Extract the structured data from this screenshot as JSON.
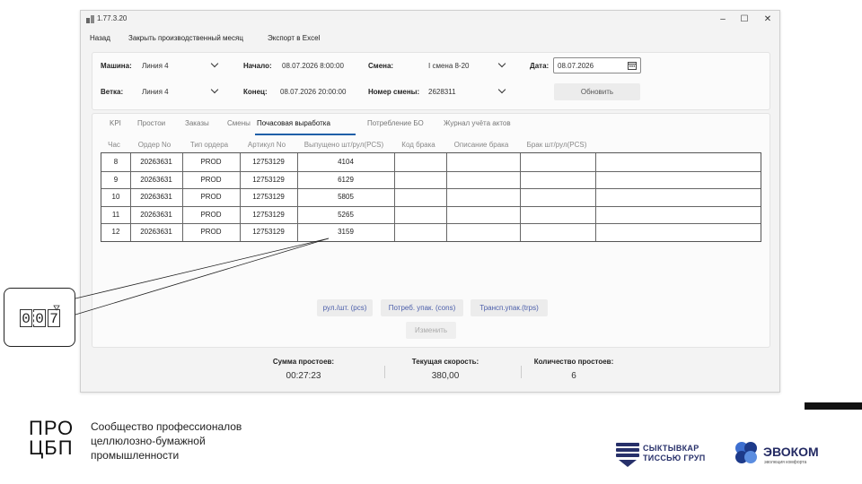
{
  "window": {
    "title": "1.77.3.20",
    "minimize": "–",
    "maximize": "☐",
    "close": "✕"
  },
  "menu": {
    "back": "Назад",
    "close_month": "Закрыть производственный месяц",
    "export": "Экспорт в Excel"
  },
  "filters": {
    "machine_label": "Машина:",
    "machine_value": "Линия 4",
    "start_label": "Начало:",
    "start_value": "08.07.2026 8:00:00",
    "shift_label": "Смена:",
    "shift_value": "I смена 8-20",
    "date_label": "Дата:",
    "date_value": "08.07.2026",
    "branch_label": "Ветка:",
    "branch_value": "Линия 4",
    "end_label": "Конец:",
    "end_value": "08.07.2026 20:00:00",
    "shift_no_label": "Номер смены:",
    "shift_no_value": "2628311",
    "refresh": "Обновить"
  },
  "tabs": [
    "KPI",
    "Простои",
    "Заказы",
    "Смены",
    "Почасовая выработка",
    "Потребление БО",
    "Журнал учёта актов"
  ],
  "active_tab": "Почасовая выработка",
  "table": {
    "columns": [
      "Час",
      "Ордер No",
      "Тип ордера",
      "Артикул No",
      "Выпущено шт/рул(PCS)",
      "Код брака",
      "Описание брака",
      "Брак шт/рул(PCS)"
    ],
    "rows": [
      [
        "8",
        "20263631",
        "PROD",
        "12753129",
        "4104",
        "",
        "",
        ""
      ],
      [
        "9",
        "20263631",
        "PROD",
        "12753129",
        "6129",
        "",
        "",
        ""
      ],
      [
        "10",
        "20263631",
        "PROD",
        "12753129",
        "5805",
        "",
        "",
        ""
      ],
      [
        "11",
        "20263631",
        "PROD",
        "12753129",
        "5265",
        "",
        "",
        ""
      ],
      [
        "12",
        "20263631",
        "PROD",
        "12753129",
        "3159",
        "",
        "",
        ""
      ]
    ]
  },
  "unit_buttons": {
    "pcs": "рул./шт. (pcs)",
    "cons": "Потреб. упак. (cons)",
    "trps": "Трансп.упак.(trps)"
  },
  "edit_button": "Изменить",
  "summary": {
    "downtime_sum_label": "Сумма простоев:",
    "downtime_sum_value": "00:27:23",
    "speed_label": "Текущая скорость:",
    "speed_value": "380,00",
    "downtime_count_label": "Количество простоев:",
    "downtime_count_value": "6"
  },
  "counter": {
    "digits": [
      "0",
      "0",
      "7"
    ]
  },
  "footer": {
    "pro_logo_top": "ПРО",
    "pro_logo_bottom": "ЦБП",
    "pro_text": [
      "Сообщество профессионалов",
      "целлюлозно-бумажной",
      "промышленности"
    ],
    "syktyvkar": [
      "СЫКТЫВКАР",
      "ТИССЬЮ ГРУП"
    ],
    "evokom": "ЭВОКОМ",
    "evokom_sub": "эволюция комфорта"
  },
  "colors": {
    "accent": "#1f5fa8",
    "unit_button_text": "#4b5eaa",
    "evokom": "#232a63"
  }
}
